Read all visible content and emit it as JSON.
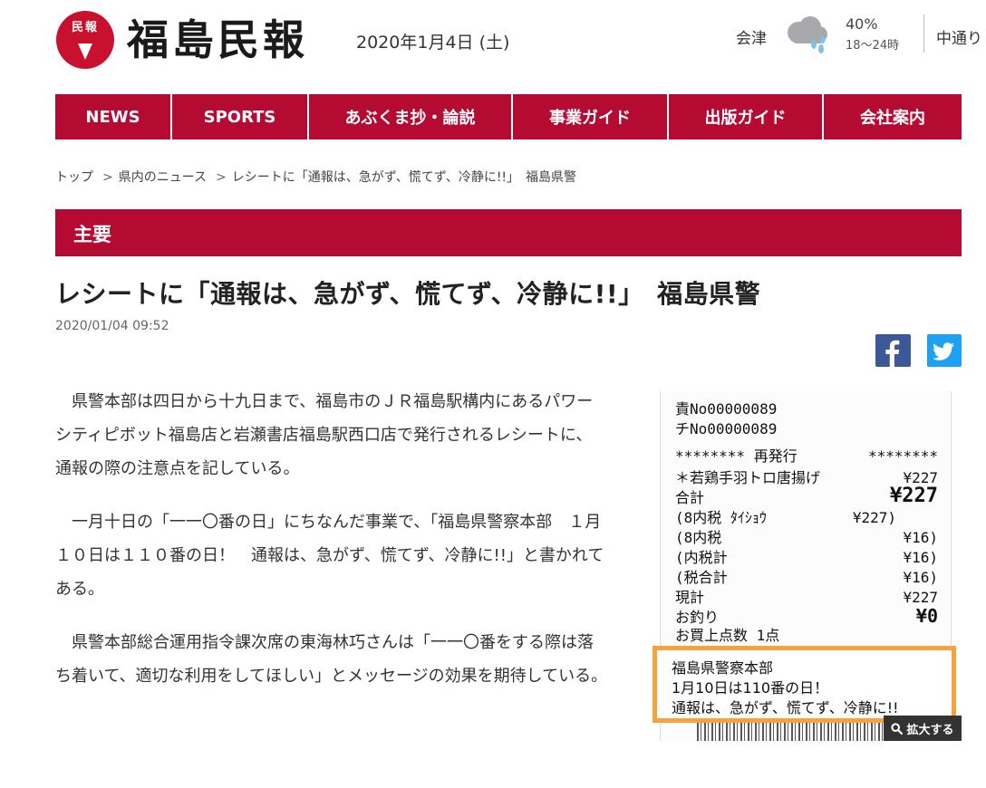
{
  "header": {
    "logo_mark_text": "民報",
    "logo_text": "福島民報",
    "date": "2020年1月4日 (土)",
    "weather": {
      "region": "会津",
      "icon": "cloud-rain-icon",
      "percent": "40%",
      "range": "18～24時"
    },
    "next_region": "中通り"
  },
  "nav": {
    "items": [
      {
        "label": "NEWS"
      },
      {
        "label": "SPORTS"
      },
      {
        "label": "あぶくま抄・論説"
      },
      {
        "label": "事業ガイド"
      },
      {
        "label": "出版ガイド"
      },
      {
        "label": "会社案内"
      }
    ]
  },
  "breadcrumb": {
    "items": [
      "トップ",
      "県内のニュース",
      "レシートに「通報は、急がず、慌てず、冷静に!!」　福島県警"
    ],
    "separator": ">"
  },
  "section": {
    "label": "主要"
  },
  "article": {
    "title": "レシートに「通報は、急がず、慌てず、冷静に!!」　福島県警",
    "date": "2020/01/04 09:52",
    "paragraphs": [
      "県警本部は四日から十九日まで、福島市のＪＲ福島駅構内にあるパワーシティピボット福島店と岩瀬書店福島駅西口店で発行されるレシートに、通報の際の注意点を記している。",
      "一月十日の「一一〇番の日」にちなんだ事業で、「福島県警察本部　１月１０日は１１０番の日！　通報は、急がず、慌てず、冷静に!!」と書かれてある。",
      "県警本部総合運用指令課次席の東海林巧さんは「一一〇番をする際は落ち着いて、適切な利用をしてほしい」とメッセージの効果を期待している。"
    ]
  },
  "share": {
    "facebook_icon": "facebook-icon",
    "twitter_icon": "twitter-icon"
  },
  "receipt": {
    "lines": [
      {
        "left": "責No00000089",
        "right": ""
      },
      {
        "left": "チNo00000089",
        "right": ""
      },
      {
        "left": "********   再発行",
        "right": "********"
      },
      {
        "left": " ＊若鶏手羽トロ唐揚げ",
        "right": "¥227"
      },
      {
        "left": "合計",
        "right": "¥227"
      },
      {
        "left": "(8内税 ﾀｲｼｮｳ",
        "right": "¥227)"
      },
      {
        "left": "(8内税",
        "right": "¥16)"
      },
      {
        "left": "(内税計",
        "right": "¥16)"
      },
      {
        "left": "(税合計",
        "right": "¥16)"
      },
      {
        "left": "現計",
        "right": "¥227"
      },
      {
        "left": "お釣り",
        "right": "¥0"
      },
      {
        "left": "お買上点数        1点",
        "right": ""
      }
    ],
    "highlight": [
      "福島県警察本部",
      "1月10日は110番の日！",
      "通報は、急がず、慌てず、冷静に!!"
    ],
    "zoom_label": "拡大する",
    "zoom_icon": "magnifier-icon"
  },
  "colors": {
    "brand": "#b50b33",
    "highlight": "#f5a33a",
    "facebook": "#3b5998",
    "twitter": "#1da1f2"
  }
}
